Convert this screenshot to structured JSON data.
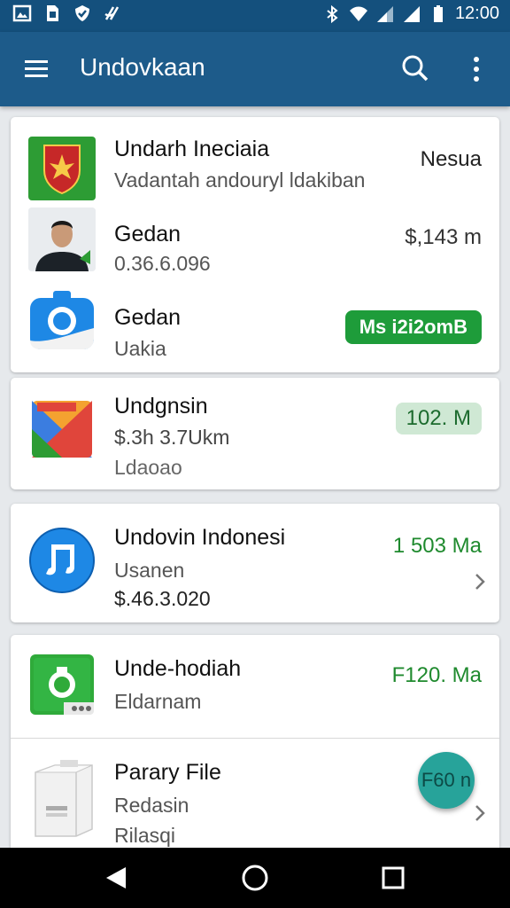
{
  "status": {
    "time": "12:00"
  },
  "appbar": {
    "title": "Undovkaan"
  },
  "card1": {
    "rows": [
      {
        "title": "Undarh Ineciaia",
        "subtitle": "Vadantah andouryl ldakiban",
        "value": "Nesua"
      },
      {
        "title": "Gedan",
        "subtitle": "0.36.6.096",
        "value": "$,143 m"
      },
      {
        "title": "Gedan",
        "subtitle": "Uakia",
        "badge": "Ms i2i2omB"
      }
    ]
  },
  "card2": {
    "title": "Undgnsin",
    "line2": "$.3h 3.7Ukm",
    "line3": "Ldaoao",
    "badge": "102. M"
  },
  "card3": {
    "title": "Undovin Indonesi",
    "line2": "Usanen",
    "line3": "$.46.3.020",
    "value": "1 503 Ma"
  },
  "card4": {
    "rows": [
      {
        "title": "Unde-hodiah",
        "subtitle": "Eldarnam",
        "value": "F120. Ma"
      },
      {
        "title": "Parary File",
        "subtitle": "Redasin",
        "subtitle2": "Rilasqi"
      }
    ]
  },
  "fab": {
    "label": "F60 n"
  },
  "colors": {
    "appbar": "#1d5b8a",
    "accent_green": "#1f8a2e",
    "fab": "#27a39a"
  }
}
